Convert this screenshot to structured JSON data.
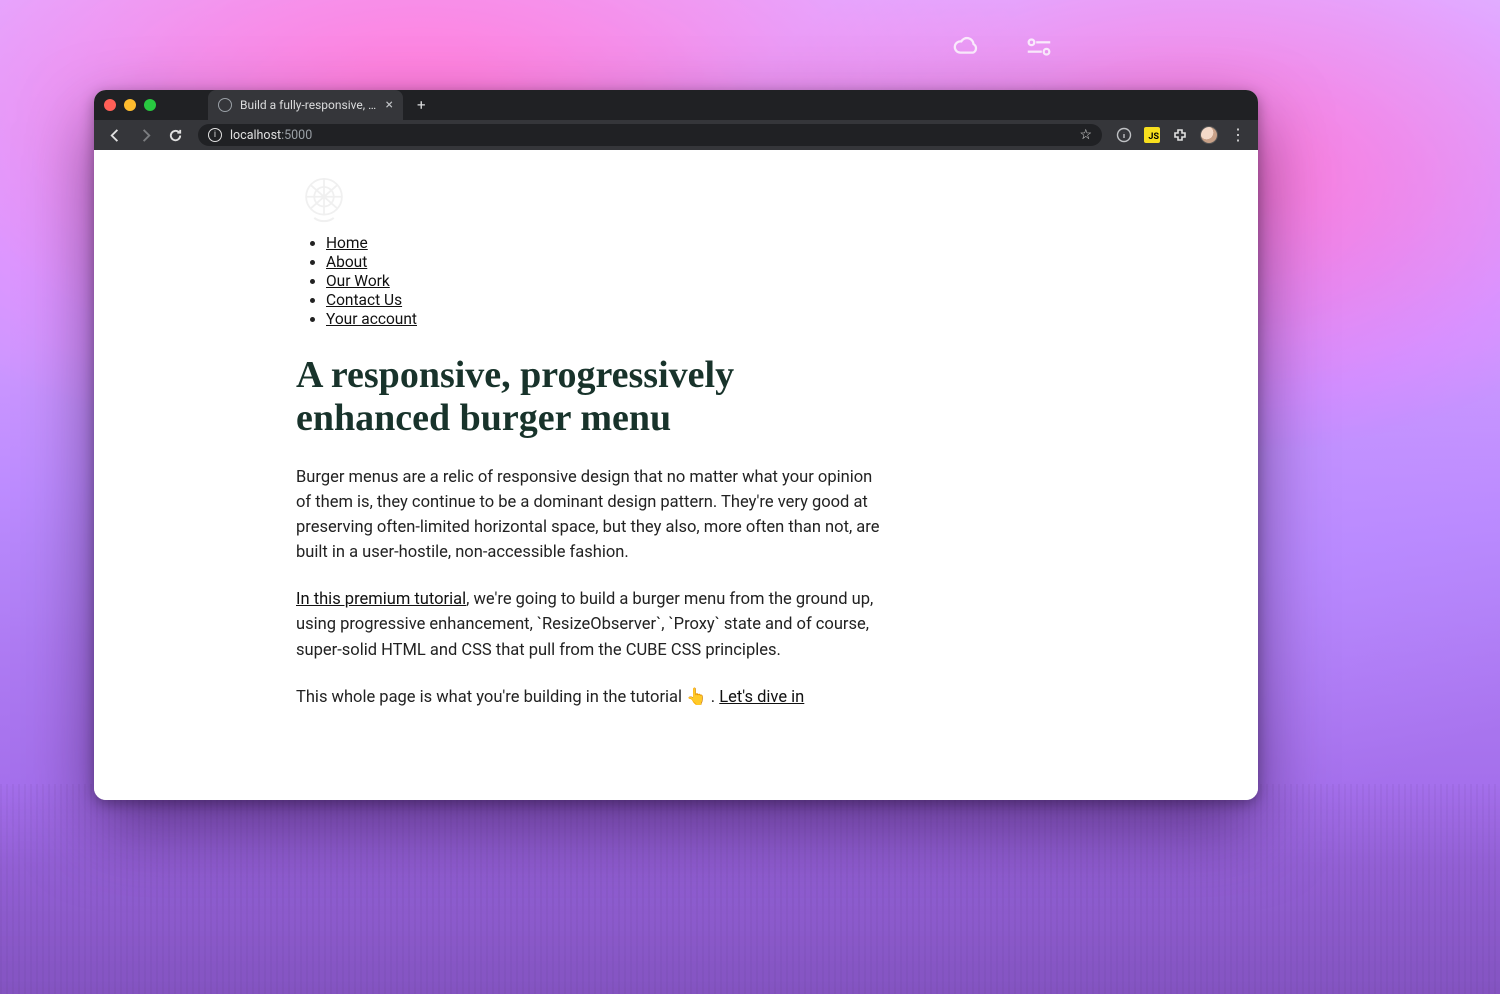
{
  "browser": {
    "tab_title": "Build a fully-responsive, progre",
    "new_tab_glyph": "+",
    "url_host": "localhost",
    "url_port": ":5000",
    "js_badge": "JS",
    "kebab_glyph": "⋮",
    "star_glyph": "☆",
    "close_glyph": "×"
  },
  "nav": {
    "items": [
      {
        "label": "Home"
      },
      {
        "label": "About"
      },
      {
        "label": "Our Work"
      },
      {
        "label": "Contact Us"
      },
      {
        "label": "Your account"
      }
    ]
  },
  "content": {
    "heading": "A responsive, progressively enhanced burger menu",
    "p1": "Burger menus are a relic of responsive design that no matter what your opinion of them is, they continue to be a dominant design pattern. They're very good at preserving often-limited horizontal space, but they also, more often than not, are built in a user-hostile, non-accessible fashion.",
    "p2_link": "In this premium tutorial",
    "p2_rest": ", we're going to build a burger menu from the ground up, using progressive enhancement, `ResizeObserver`, `Proxy` state and of course, super-solid HTML and CSS that pull from the CUBE CSS principles.",
    "p3_before": "This whole page is what you're building in the tutorial ",
    "p3_emoji": "👆",
    "p3_middle": " . ",
    "p3_link": "Let's dive in"
  }
}
